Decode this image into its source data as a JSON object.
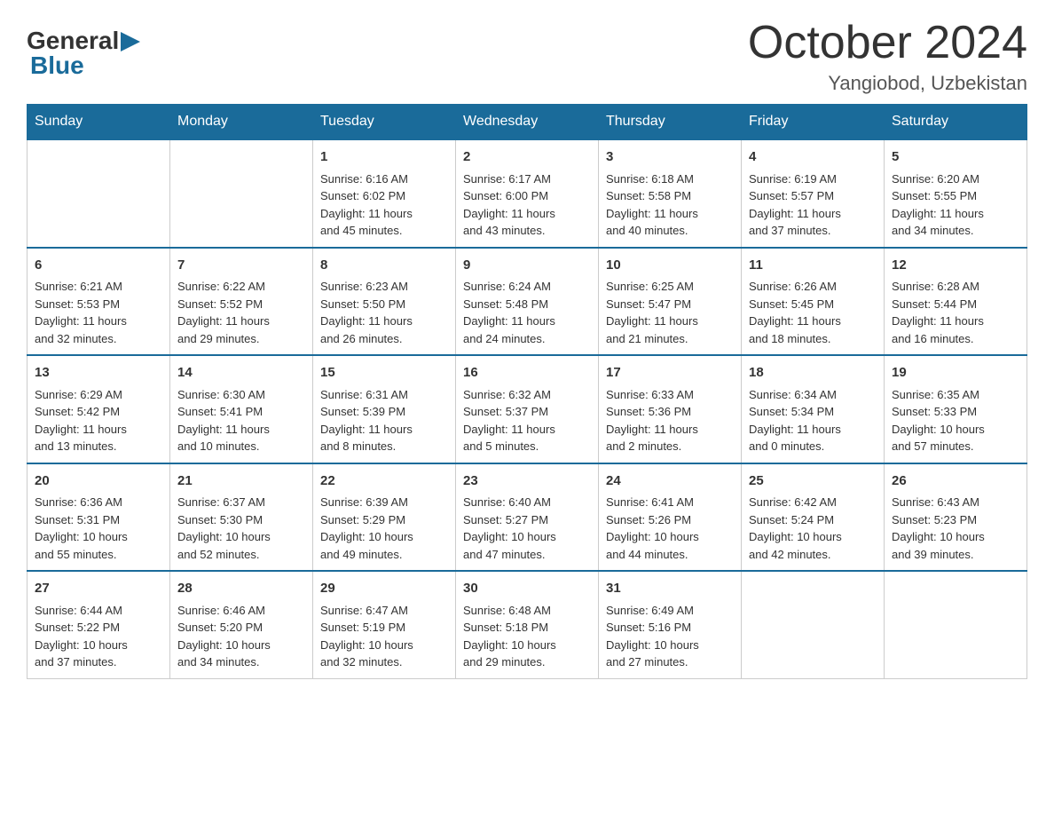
{
  "logo": {
    "general": "General",
    "blue": "Blue",
    "arrow": "▶"
  },
  "title": "October 2024",
  "subtitle": "Yangiobod, Uzbekistan",
  "days_of_week": [
    "Sunday",
    "Monday",
    "Tuesday",
    "Wednesday",
    "Thursday",
    "Friday",
    "Saturday"
  ],
  "weeks": [
    [
      {
        "day": "",
        "info": ""
      },
      {
        "day": "",
        "info": ""
      },
      {
        "day": "1",
        "info": "Sunrise: 6:16 AM\nSunset: 6:02 PM\nDaylight: 11 hours\nand 45 minutes."
      },
      {
        "day": "2",
        "info": "Sunrise: 6:17 AM\nSunset: 6:00 PM\nDaylight: 11 hours\nand 43 minutes."
      },
      {
        "day": "3",
        "info": "Sunrise: 6:18 AM\nSunset: 5:58 PM\nDaylight: 11 hours\nand 40 minutes."
      },
      {
        "day": "4",
        "info": "Sunrise: 6:19 AM\nSunset: 5:57 PM\nDaylight: 11 hours\nand 37 minutes."
      },
      {
        "day": "5",
        "info": "Sunrise: 6:20 AM\nSunset: 5:55 PM\nDaylight: 11 hours\nand 34 minutes."
      }
    ],
    [
      {
        "day": "6",
        "info": "Sunrise: 6:21 AM\nSunset: 5:53 PM\nDaylight: 11 hours\nand 32 minutes."
      },
      {
        "day": "7",
        "info": "Sunrise: 6:22 AM\nSunset: 5:52 PM\nDaylight: 11 hours\nand 29 minutes."
      },
      {
        "day": "8",
        "info": "Sunrise: 6:23 AM\nSunset: 5:50 PM\nDaylight: 11 hours\nand 26 minutes."
      },
      {
        "day": "9",
        "info": "Sunrise: 6:24 AM\nSunset: 5:48 PM\nDaylight: 11 hours\nand 24 minutes."
      },
      {
        "day": "10",
        "info": "Sunrise: 6:25 AM\nSunset: 5:47 PM\nDaylight: 11 hours\nand 21 minutes."
      },
      {
        "day": "11",
        "info": "Sunrise: 6:26 AM\nSunset: 5:45 PM\nDaylight: 11 hours\nand 18 minutes."
      },
      {
        "day": "12",
        "info": "Sunrise: 6:28 AM\nSunset: 5:44 PM\nDaylight: 11 hours\nand 16 minutes."
      }
    ],
    [
      {
        "day": "13",
        "info": "Sunrise: 6:29 AM\nSunset: 5:42 PM\nDaylight: 11 hours\nand 13 minutes."
      },
      {
        "day": "14",
        "info": "Sunrise: 6:30 AM\nSunset: 5:41 PM\nDaylight: 11 hours\nand 10 minutes."
      },
      {
        "day": "15",
        "info": "Sunrise: 6:31 AM\nSunset: 5:39 PM\nDaylight: 11 hours\nand 8 minutes."
      },
      {
        "day": "16",
        "info": "Sunrise: 6:32 AM\nSunset: 5:37 PM\nDaylight: 11 hours\nand 5 minutes."
      },
      {
        "day": "17",
        "info": "Sunrise: 6:33 AM\nSunset: 5:36 PM\nDaylight: 11 hours\nand 2 minutes."
      },
      {
        "day": "18",
        "info": "Sunrise: 6:34 AM\nSunset: 5:34 PM\nDaylight: 11 hours\nand 0 minutes."
      },
      {
        "day": "19",
        "info": "Sunrise: 6:35 AM\nSunset: 5:33 PM\nDaylight: 10 hours\nand 57 minutes."
      }
    ],
    [
      {
        "day": "20",
        "info": "Sunrise: 6:36 AM\nSunset: 5:31 PM\nDaylight: 10 hours\nand 55 minutes."
      },
      {
        "day": "21",
        "info": "Sunrise: 6:37 AM\nSunset: 5:30 PM\nDaylight: 10 hours\nand 52 minutes."
      },
      {
        "day": "22",
        "info": "Sunrise: 6:39 AM\nSunset: 5:29 PM\nDaylight: 10 hours\nand 49 minutes."
      },
      {
        "day": "23",
        "info": "Sunrise: 6:40 AM\nSunset: 5:27 PM\nDaylight: 10 hours\nand 47 minutes."
      },
      {
        "day": "24",
        "info": "Sunrise: 6:41 AM\nSunset: 5:26 PM\nDaylight: 10 hours\nand 44 minutes."
      },
      {
        "day": "25",
        "info": "Sunrise: 6:42 AM\nSunset: 5:24 PM\nDaylight: 10 hours\nand 42 minutes."
      },
      {
        "day": "26",
        "info": "Sunrise: 6:43 AM\nSunset: 5:23 PM\nDaylight: 10 hours\nand 39 minutes."
      }
    ],
    [
      {
        "day": "27",
        "info": "Sunrise: 6:44 AM\nSunset: 5:22 PM\nDaylight: 10 hours\nand 37 minutes."
      },
      {
        "day": "28",
        "info": "Sunrise: 6:46 AM\nSunset: 5:20 PM\nDaylight: 10 hours\nand 34 minutes."
      },
      {
        "day": "29",
        "info": "Sunrise: 6:47 AM\nSunset: 5:19 PM\nDaylight: 10 hours\nand 32 minutes."
      },
      {
        "day": "30",
        "info": "Sunrise: 6:48 AM\nSunset: 5:18 PM\nDaylight: 10 hours\nand 29 minutes."
      },
      {
        "day": "31",
        "info": "Sunrise: 6:49 AM\nSunset: 5:16 PM\nDaylight: 10 hours\nand 27 minutes."
      },
      {
        "day": "",
        "info": ""
      },
      {
        "day": "",
        "info": ""
      }
    ]
  ]
}
